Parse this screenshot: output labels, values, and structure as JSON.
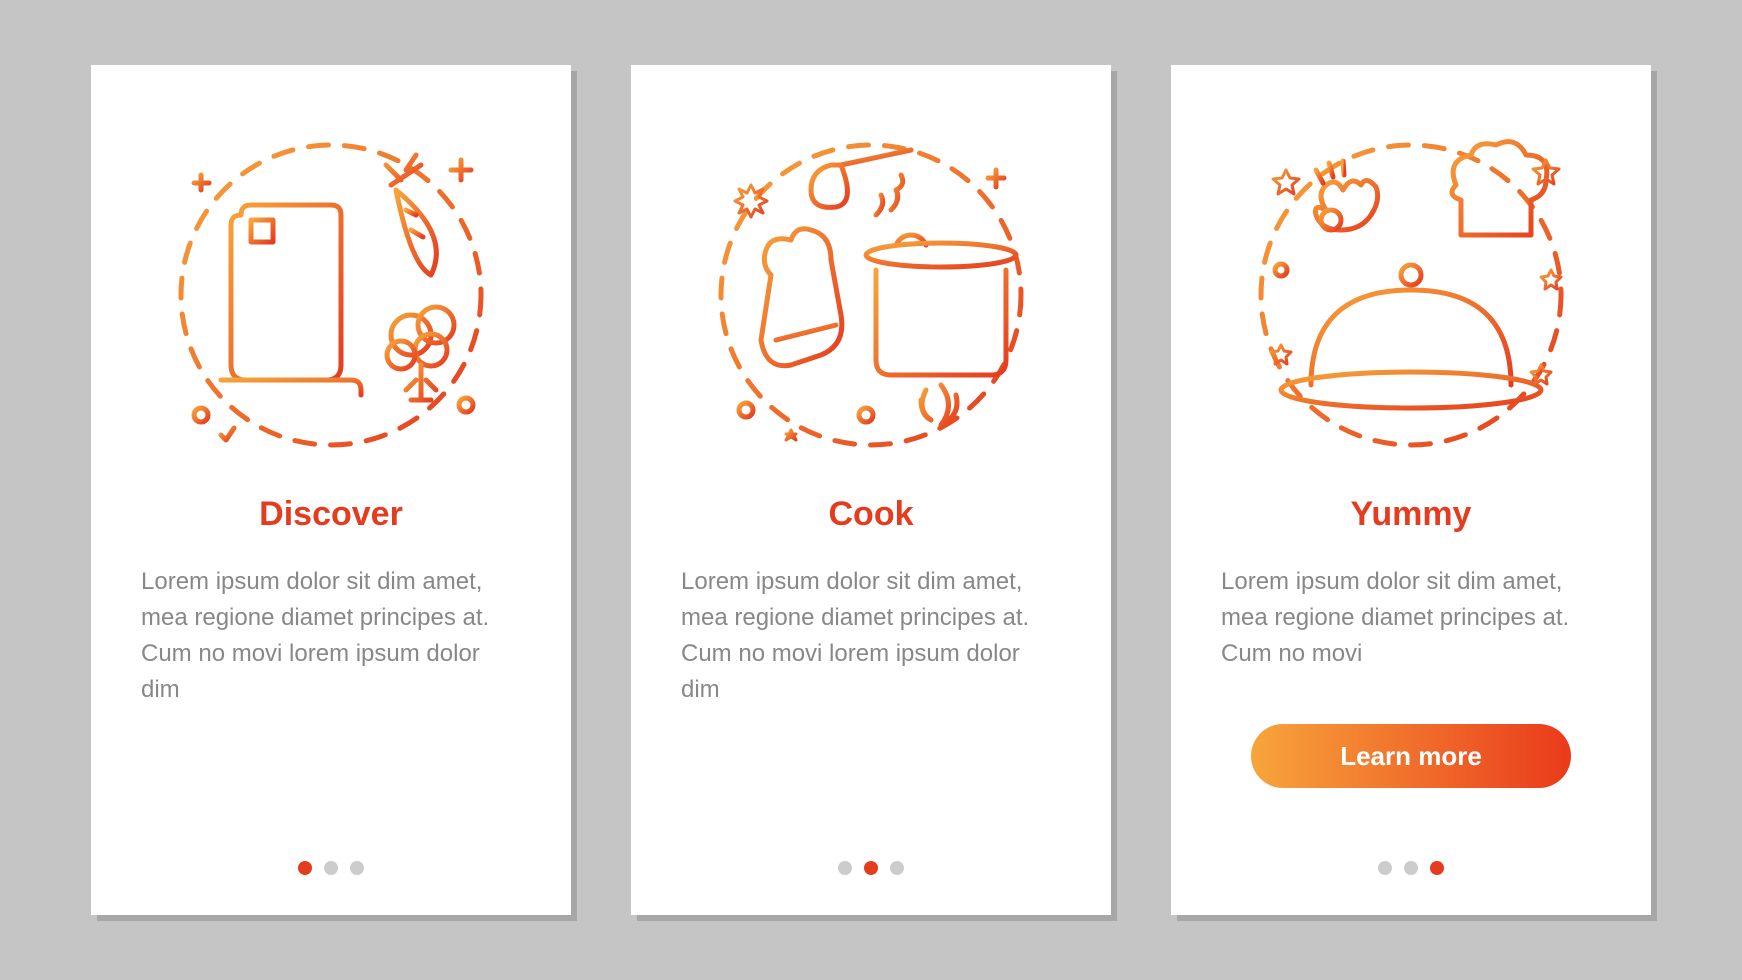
{
  "colors": {
    "accent": "#e53b1f",
    "gradient_start": "#f7a53b",
    "gradient_end": "#ea3a1c",
    "text_muted": "#888888",
    "background": "#c5c5c5",
    "card_bg": "#ffffff",
    "dot_inactive": "#cccccc"
  },
  "cards": [
    {
      "title": "Discover",
      "body": "Lorem ipsum dolor sit dim amet, mea regione diamet principes at. Cum no movi lorem ipsum dolor dim",
      "icon": "discover-recipe-icon",
      "active_dot": 0,
      "has_button": false
    },
    {
      "title": "Cook",
      "body": "Lorem ipsum dolor sit dim amet, mea regione diamet principes at. Cum no movi lorem ipsum dolor dim",
      "icon": "cook-pot-icon",
      "active_dot": 1,
      "has_button": false
    },
    {
      "title": "Yummy",
      "body": "Lorem ipsum dolor sit dim amet, mea regione diamet principes at. Cum no movi",
      "icon": "yummy-dish-icon",
      "active_dot": 2,
      "has_button": true
    }
  ],
  "button_label": "Learn more",
  "dots_count": 3
}
